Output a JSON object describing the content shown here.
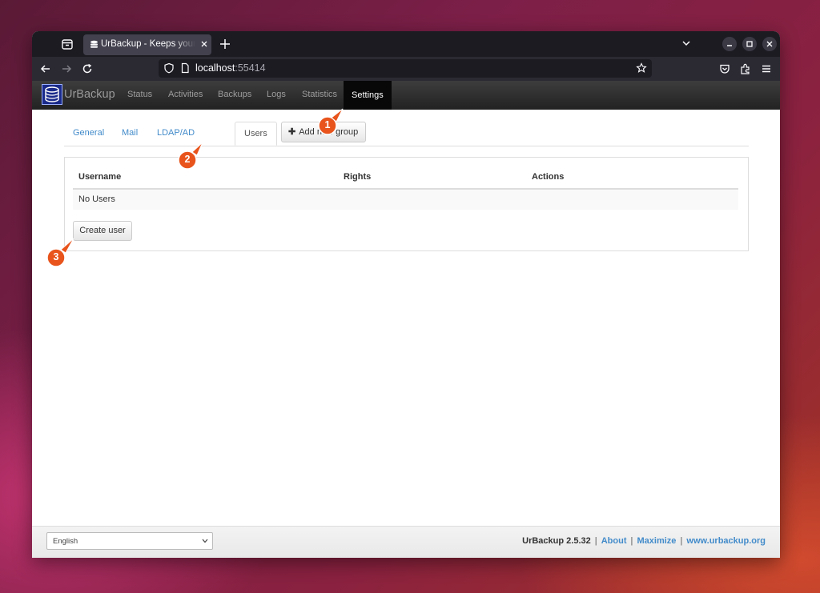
{
  "browser": {
    "tab_title": "UrBackup - Keeps your data safe",
    "url_host": "localhost",
    "url_port": ":55414"
  },
  "app": {
    "brand": "UrBackup",
    "nav": [
      "Status",
      "Activities",
      "Backups",
      "Logs",
      "Statistics",
      "Settings"
    ],
    "active_nav": "Settings"
  },
  "settings": {
    "tabs": [
      "General",
      "Mail",
      "LDAP/AD",
      "Users"
    ],
    "active_tab": "Users",
    "add_group_label": "Add new group"
  },
  "users_table": {
    "columns": [
      "Username",
      "Rights",
      "Actions"
    ],
    "empty_text": "No Users",
    "create_button": "Create user"
  },
  "footer": {
    "language": "English",
    "version": "UrBackup 2.5.32",
    "links": [
      "About",
      "Maximize",
      "www.urbackup.org"
    ]
  },
  "callouts": [
    "1",
    "2",
    "3"
  ],
  "colors": {
    "link": "#428bca",
    "callout": "#e8541c"
  }
}
